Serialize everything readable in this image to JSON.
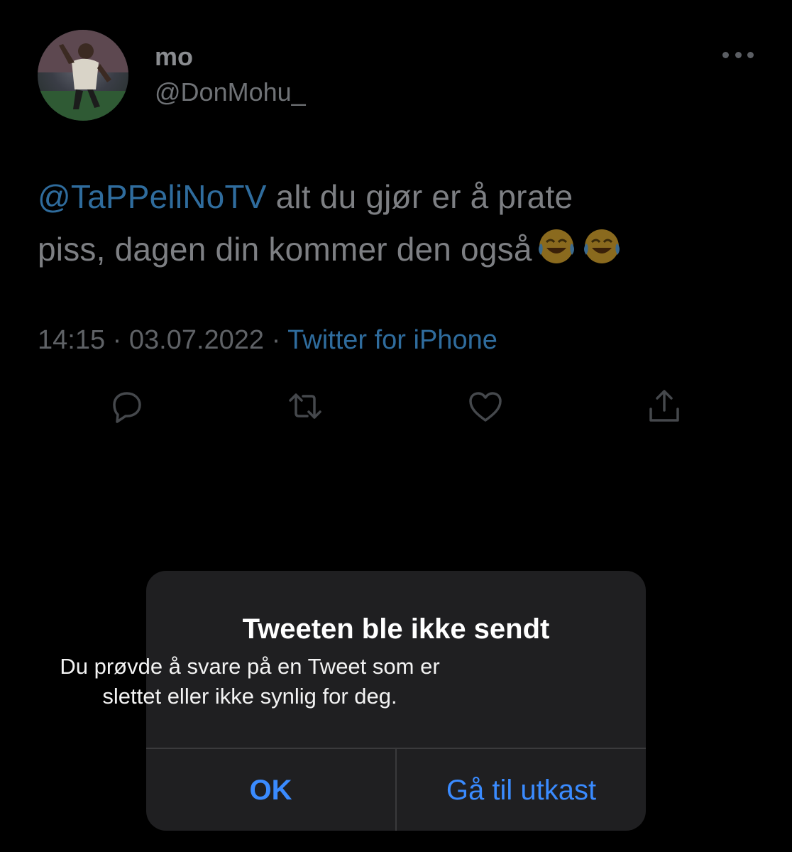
{
  "tweet": {
    "display_name": "mo",
    "handle": "@DonMohu_",
    "mention": "@TaPPeliNoTV",
    "text_line1_rest": " alt du gjør er å prate",
    "text_line2": "piss, dagen din kommer den også",
    "emojis": [
      "face-with-tears-of-joy",
      "face-with-tears-of-joy"
    ],
    "time": "14:15",
    "separator1": " · ",
    "date": "03.07.2022",
    "separator2": " · ",
    "source": "Twitter for iPhone",
    "mention_color": "#2f6c9d"
  },
  "actions": {
    "reply_icon": "reply-icon",
    "retweet_icon": "retweet-icon",
    "like_icon": "heart-icon",
    "share_icon": "share-icon"
  },
  "dialog": {
    "title": "Tweeten ble ikke sendt",
    "message_line1": "Du prøvde å svare på en Tweet som er",
    "message_line2": "slettet eller ikke synlig for deg.",
    "ok_label": "OK",
    "draft_label": "Gå til utkast",
    "button_color": "#3a8bff"
  }
}
